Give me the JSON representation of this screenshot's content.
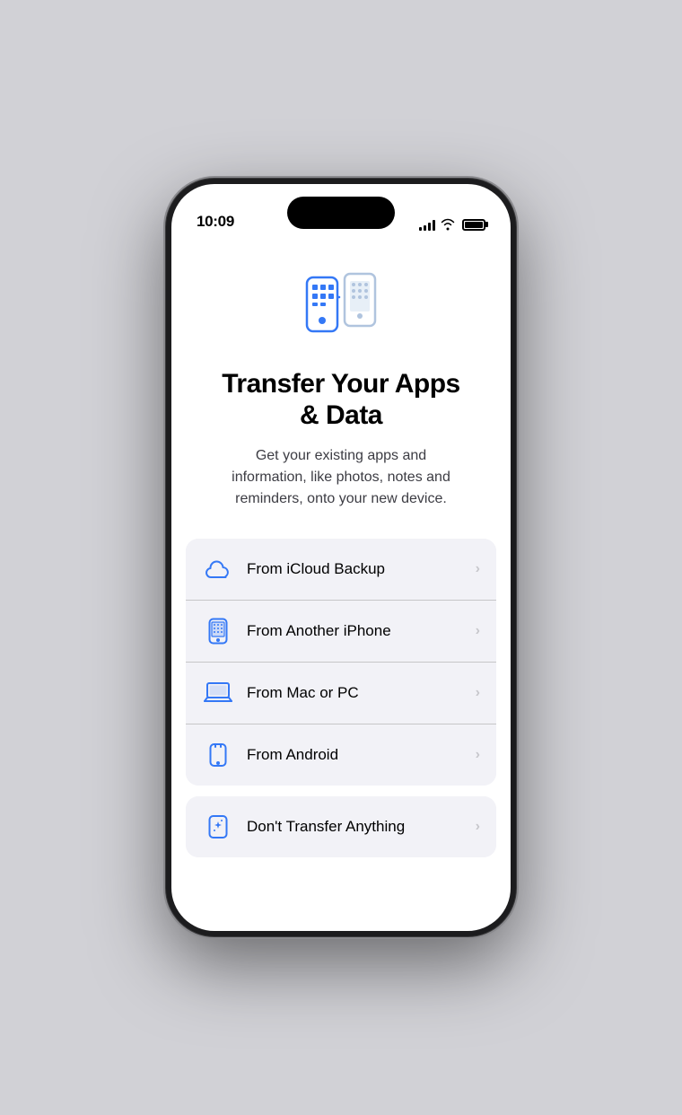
{
  "status_bar": {
    "time": "10:09",
    "signal_aria": "signal",
    "wifi_aria": "wifi",
    "battery_aria": "battery"
  },
  "page": {
    "title": "Transfer Your Apps\n& Data",
    "subtitle": "Get your existing apps and information, like photos, notes and reminders, onto your new device.",
    "icon_aria": "transfer-phones-icon"
  },
  "options": [
    {
      "id": "icloud",
      "label": "From iCloud Backup",
      "icon": "cloud"
    },
    {
      "id": "another-iphone",
      "label": "From Another iPhone",
      "icon": "iphone"
    },
    {
      "id": "mac-pc",
      "label": "From Mac or PC",
      "icon": "laptop"
    },
    {
      "id": "android",
      "label": "From Android",
      "icon": "android-phone"
    }
  ],
  "secondary_options": [
    {
      "id": "dont-transfer",
      "label": "Don't Transfer Anything",
      "icon": "sparkle-phone"
    }
  ],
  "chevron": "›"
}
